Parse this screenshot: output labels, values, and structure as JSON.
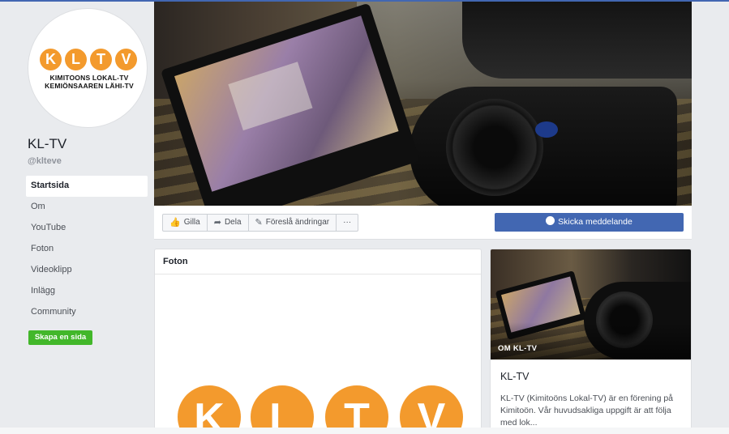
{
  "page": {
    "name": "KL-TV",
    "handle": "@klteve"
  },
  "logo": {
    "letters": [
      "K",
      "L",
      "T",
      "V"
    ],
    "line1": "KIMITOONS LOKAL-TV",
    "line2": "KEMIÖNSAAREN LÄHI-TV",
    "color": "#f39a2d"
  },
  "nav": {
    "items": [
      {
        "label": "Startsida",
        "active": true
      },
      {
        "label": "Om"
      },
      {
        "label": "YouTube"
      },
      {
        "label": "Foton"
      },
      {
        "label": "Videoklipp"
      },
      {
        "label": "Inlägg"
      },
      {
        "label": "Community"
      }
    ]
  },
  "create_page_label": "Skapa en sida",
  "actions": {
    "like": "Gilla",
    "share": "Dela",
    "suggest": "Föreslå ändringar",
    "more": "···",
    "message": "Skicka meddelande"
  },
  "photos": {
    "title": "Foton"
  },
  "about": {
    "photo_label": "OM KL-TV",
    "name": "KL-TV",
    "description": "KL-TV (Kimitoöns Lokal-TV) är en förening på Kimitoön. Vår huvudsakliga uppgift är att följa med lok..."
  },
  "colors": {
    "brand_blue": "#4267b2",
    "create_green": "#42b72a",
    "background": "#e9ebee"
  }
}
